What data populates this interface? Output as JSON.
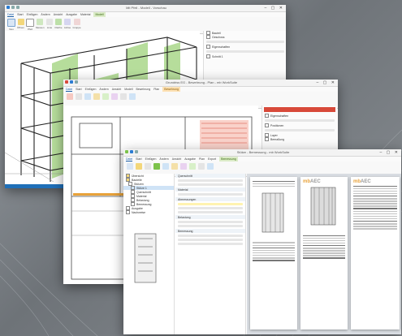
{
  "window1": {
    "title": "Mit Pfeil - Modell - Vorschau",
    "tabs": [
      "Datei",
      "Start",
      "Einfügen",
      "Ändern",
      "Ansicht",
      "Ausgabe",
      "Material"
    ],
    "context_tab": "Modell",
    "ribbon": [
      "Neu",
      "Öffnen",
      "Pfeil",
      "Messen",
      "Linie",
      "Fläche",
      "Achse",
      "Gruppe"
    ],
    "side_items": [
      "Bauteil",
      "Geschoss",
      "Eigenschaften",
      "Schnitt 1"
    ]
  },
  "window2": {
    "title": "Grundriss EG - Bewehrung - Plan - mb WorkSuite",
    "tabs": [
      "Datei",
      "Start",
      "Einfügen",
      "Ändern",
      "Ansicht",
      "Modell",
      "Bewehrung",
      "Plan"
    ],
    "context_tab": "Bewehrung",
    "side_items": [
      "Eigenschaften",
      "Positionen",
      "Layer",
      "Bemaßung"
    ]
  },
  "window3": {
    "title": "Stütze - Bemessung - mb WorkSuite",
    "tabs": [
      "Datei",
      "Start",
      "Einfügen",
      "Ändern",
      "Ansicht",
      "Ausgabe",
      "Plan",
      "Export"
    ],
    "context_tab": "Bemessung",
    "tree_items": [
      "Übersicht",
      "Bauteile",
      "Stützen",
      "Stütze 1",
      "Querschnitt",
      "Material",
      "Belastung",
      "Bemessung",
      "Ausgabe",
      "Nachweise"
    ],
    "form_sections": [
      "Querschnitt",
      "Material",
      "Abmessungen",
      "Belastung",
      "Bemessung"
    ],
    "logo": "mb",
    "logo_suffix": "AEC"
  },
  "colors": {
    "accent_blue": "#1f6fb8",
    "accent_green": "#7cc24a",
    "accent_orange": "#e8a23a",
    "accent_red": "#d84a3a"
  }
}
